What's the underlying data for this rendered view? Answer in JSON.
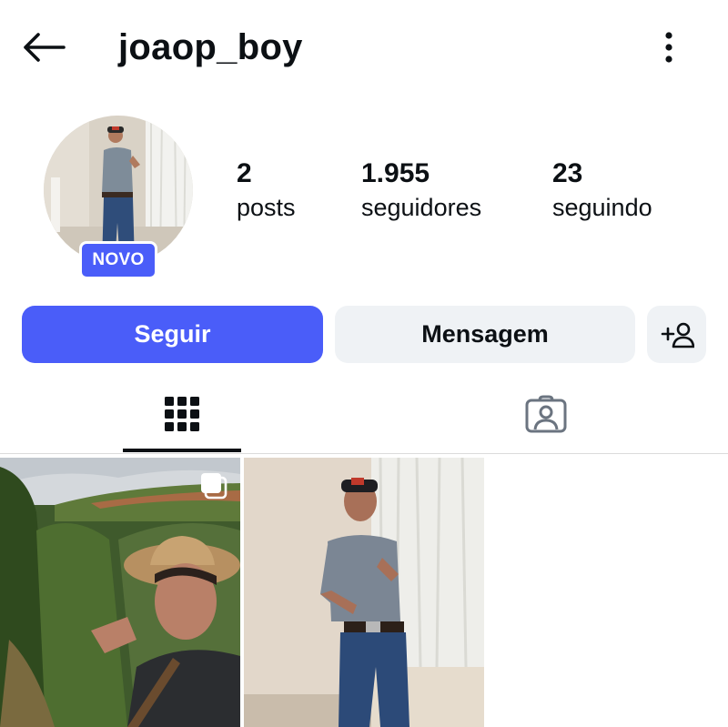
{
  "header": {
    "username": "joaop_boy",
    "back_icon": "arrow-left-icon",
    "more_icon": "more-vertical-icon"
  },
  "profile": {
    "badge": "NOVO",
    "stats": [
      {
        "value": "2",
        "label": "posts"
      },
      {
        "value": "1.955",
        "label": "seguidores"
      },
      {
        "value": "23",
        "label": "seguindo"
      }
    ]
  },
  "actions": {
    "follow_label": "Seguir",
    "message_label": "Mensagem",
    "add_user_icon": "add-user-icon"
  },
  "tabs": {
    "items": [
      {
        "icon": "grid-icon",
        "active": true
      },
      {
        "icon": "tagged-person-icon",
        "active": false
      }
    ]
  },
  "posts": [
    {
      "type": "carousel",
      "icon": "carousel-icon"
    },
    {
      "type": "single"
    }
  ],
  "colors": {
    "accent": "#4a5df9",
    "secondary_button": "#eff2f5",
    "text": "#0c1014"
  }
}
